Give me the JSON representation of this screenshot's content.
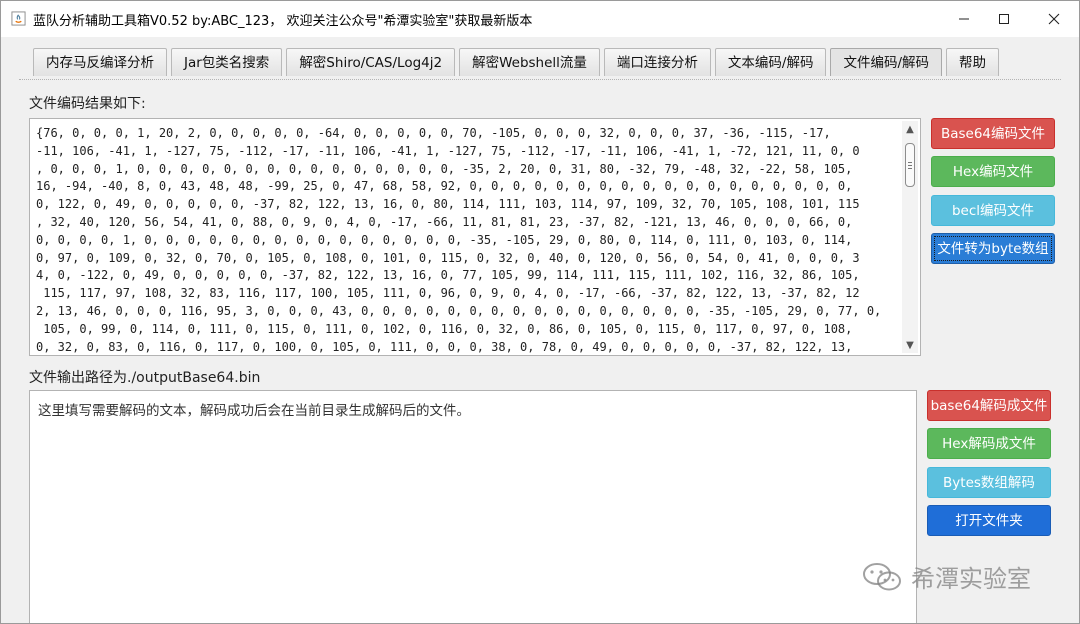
{
  "window": {
    "title": "蓝队分析辅助工具箱V0.52 by:ABC_123， 欢迎关注公众号\"希潭实验室\"获取最新版本",
    "minimize": "—",
    "maximize": "☐",
    "close": "✕"
  },
  "tabs": [
    {
      "label": "内存马反编译分析"
    },
    {
      "label": "Jar包类名搜索"
    },
    {
      "label": "解密Shiro/CAS/Log4j2"
    },
    {
      "label": "解密Webshell流量"
    },
    {
      "label": "端口连接分析"
    },
    {
      "label": "文本编码/解码"
    },
    {
      "label": "文件编码/解码",
      "active": true
    },
    {
      "label": "帮助"
    }
  ],
  "result": {
    "label": "文件编码结果如下:",
    "lines": [
      "{76, 0, 0, 0, 1, 20, 2, 0, 0, 0, 0, 0, -64, 0, 0, 0, 0, 0, 70, -105, 0, 0, 0, 32, 0, 0, 0, 37, -36, -115, -17,",
      "-11, 106, -41, 1, -127, 75, -112, -17, -11, 106, -41, 1, -127, 75, -112, -17, -11, 106, -41, 1, -72, 121, 11, 0, 0",
      ", 0, 0, 0, 1, 0, 0, 0, 0, 0, 0, 0, 0, 0, 0, 0, 0, 0, 0, 0, -35, 2, 20, 0, 31, 80, -32, 79, -48, 32, -22, 58, 105,",
      "16, -94, -40, 8, 0, 43, 48, 48, -99, 25, 0, 47, 68, 58, 92, 0, 0, 0, 0, 0, 0, 0, 0, 0, 0, 0, 0, 0, 0, 0, 0, 0, 0,",
      "0, 122, 0, 49, 0, 0, 0, 0, 0, -37, 82, 122, 13, 16, 0, 80, 114, 111, 103, 114, 97, 109, 32, 70, 105, 108, 101, 115",
      ", 32, 40, 120, 56, 54, 41, 0, 88, 0, 9, 0, 4, 0, -17, -66, 11, 81, 81, 23, -37, 82, -121, 13, 46, 0, 0, 0, 66, 0,",
      "0, 0, 0, 0, 1, 0, 0, 0, 0, 0, 0, 0, 0, 0, 0, 0, 0, 0, 0, 0, -35, -105, 29, 0, 80, 0, 114, 0, 111, 0, 103, 0, 114,",
      "0, 97, 0, 109, 0, 32, 0, 70, 0, 105, 0, 108, 0, 101, 0, 115, 0, 32, 0, 40, 0, 120, 0, 56, 0, 54, 0, 41, 0, 0, 0, 3",
      "4, 0, -122, 0, 49, 0, 0, 0, 0, 0, -37, 82, 122, 13, 16, 0, 77, 105, 99, 114, 111, 115, 111, 102, 116, 32, 86, 105,",
      " 115, 117, 97, 108, 32, 83, 116, 117, 100, 105, 111, 0, 96, 0, 9, 0, 4, 0, -17, -66, -37, 82, 122, 13, -37, 82, 12",
      "2, 13, 46, 0, 0, 0, 116, 95, 3, 0, 0, 0, 43, 0, 0, 0, 0, 0, 0, 0, 0, 0, 0, 0, 0, 0, 0, 0, 0, -35, -105, 29, 0, 77, 0,",
      " 105, 0, 99, 0, 114, 0, 111, 0, 115, 0, 111, 0, 102, 0, 116, 0, 32, 0, 86, 0, 105, 0, 115, 0, 117, 0, 97, 0, 108,",
      "0, 32, 0, 83, 0, 116, 0, 117, 0, 100, 0, 105, 0, 111, 0, 0, 0, 38, 0, 78, 0, 49, 0, 0, 0, 0, 0, -37, 82, 122, 13,"
    ]
  },
  "output_path": "文件输出路径为./outputBase64.bin",
  "decode_input": {
    "placeholder": "这里填写需要解码的文本，解码成功后会在当前目录生成解码后的文件。"
  },
  "encode_buttons": {
    "base64": "Base64编码文件",
    "hex": "Hex编码文件",
    "bcel": "becl编码文件",
    "bytes": "文件转为byte数组"
  },
  "decode_buttons": {
    "base64": "base64解码成文件",
    "hex": "Hex解码成文件",
    "bytes": "Bytes数组解码",
    "open_folder": "打开文件夹"
  },
  "watermark": "希潭实验室",
  "colors": {
    "red": "#d9534f",
    "green": "#5cb85c",
    "cyan": "#5bc0de",
    "blue": "#2a7dd6"
  }
}
